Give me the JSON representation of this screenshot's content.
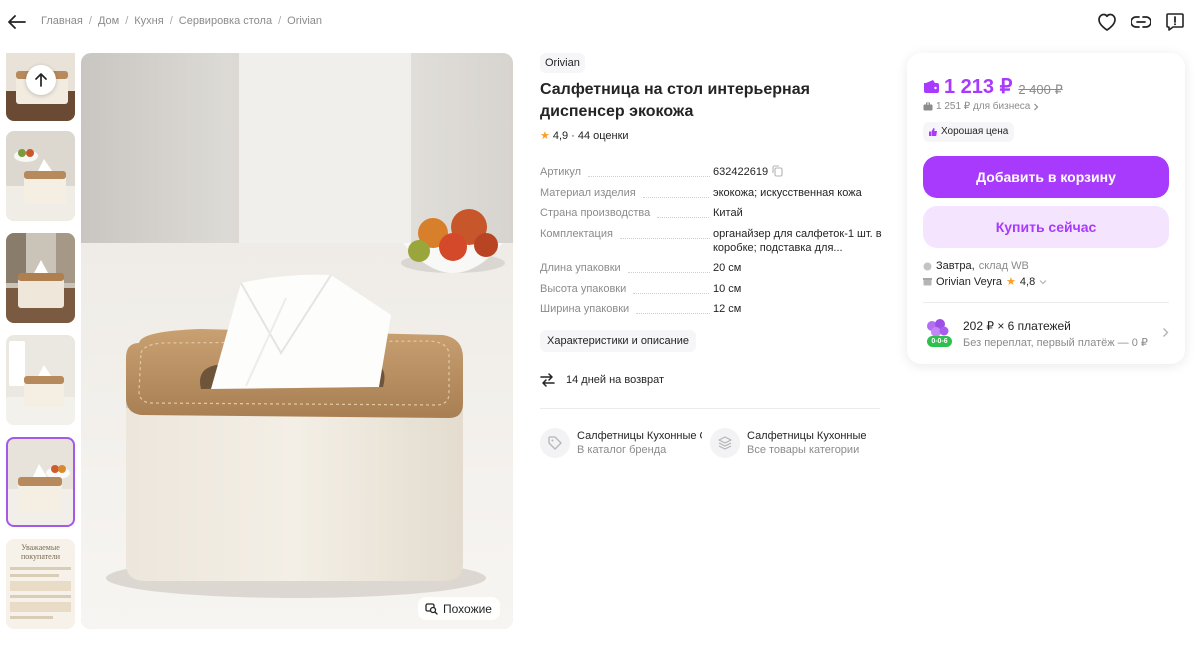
{
  "breadcrumb": [
    "Главная",
    "Дом",
    "Кухня",
    "Сервировка стола",
    "Orivian"
  ],
  "thumbnail_card": {
    "title": "Уважаемые покупатели"
  },
  "main_image": {
    "similar_label": "Похожие"
  },
  "product": {
    "brand": "Orivian",
    "title": "Салфетница на стол интерьерная диспенсер экокожа",
    "rating": "4,9",
    "rating_sep": "·",
    "reviews": "44 оценки"
  },
  "specs": [
    {
      "name": "Артикул",
      "value": "632422619"
    },
    {
      "name": "Материал изделия",
      "value": "экокожа; искусственная кожа"
    },
    {
      "name": "Страна производства",
      "value": "Китай"
    },
    {
      "name": "Комплектация",
      "value": "органайзер для салфеток-1 шт. в коробке; подставка для..."
    },
    {
      "name": "Длина упаковки",
      "value": "20 см"
    },
    {
      "name": "Высота упаковки",
      "value": "10 см"
    },
    {
      "name": "Ширина упаковки",
      "value": "12 см"
    }
  ],
  "characteristics_button": "Характеристики и описание",
  "return_text": "14 дней на возврат",
  "links": [
    {
      "title": "Салфетницы Кухонные Orivian",
      "subtitle": "В каталог бренда"
    },
    {
      "title": "Салфетницы Кухонные",
      "subtitle": "Все товары категории"
    }
  ],
  "price_card": {
    "price": "1 213 ₽",
    "old_price": "2 400 ₽",
    "business_price": "1 251 ₽ для бизнеса",
    "good_price": "Хорошая цена",
    "add_to_cart": "Добавить в корзину",
    "buy_now": "Купить сейчас",
    "delivery_day": "Завтра,",
    "delivery_warehouse": "склад WB",
    "seller_name": "Orivian Veyra",
    "seller_rating": "4,8",
    "installment_title": "202 ₽ × 6 платежей",
    "installment_subtitle": "Без переплат, первый платёж — 0 ₽",
    "installment_badge": "0-0-6"
  },
  "colors": {
    "accent": "#a73afd",
    "accent_light": "#f5e4fe",
    "star": "#ff9c22",
    "active_thumb_border": "#a45ae6"
  },
  "icons": [
    "arrow-left-icon",
    "heart-icon",
    "link-icon",
    "report-icon",
    "arrow-up-icon",
    "search-similar-icon",
    "star-icon",
    "copy-icon",
    "return-arrows-icon",
    "tag-icon",
    "layers-icon",
    "wallet-icon",
    "chevron-right-icon",
    "thumbs-up-icon",
    "pin-icon",
    "store-icon",
    "chevron-down-icon",
    "installment-badge-icon"
  ]
}
